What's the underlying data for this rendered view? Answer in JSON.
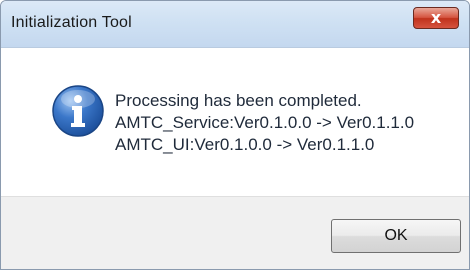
{
  "window": {
    "title": "Initialization Tool",
    "close_glyph": "x"
  },
  "message": {
    "icon": "info-icon",
    "lines": [
      "Processing has been completed.",
      "AMTC_Service:Ver0.1.0.0 -> Ver0.1.1.0",
      "AMTC_UI:Ver0.1.0.0 -> Ver0.1.1.0"
    ]
  },
  "buttons": {
    "ok_label": "OK"
  },
  "colors": {
    "titlebar": "#cfe1f3",
    "close_button": "#c0321c",
    "info_icon": "#2a62b8",
    "footer": "#f0f0f0"
  }
}
